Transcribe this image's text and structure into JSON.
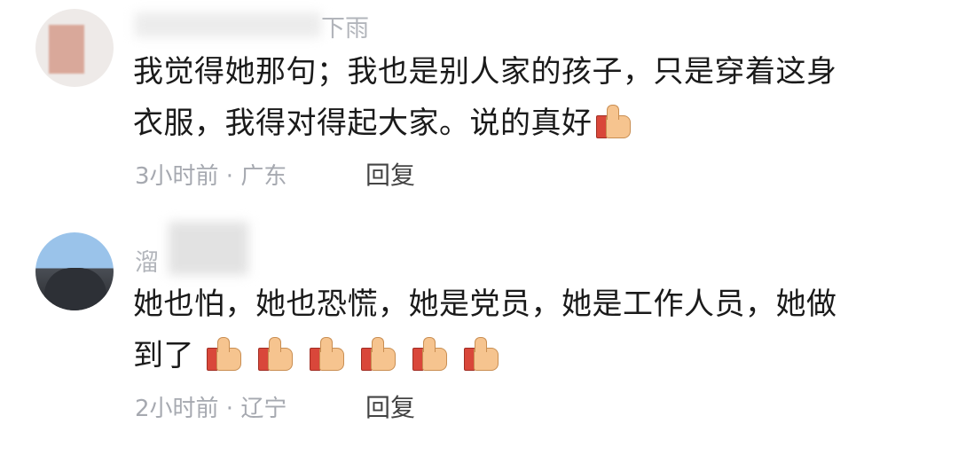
{
  "comments": [
    {
      "username_visible": "下雨",
      "text_line1": "我觉得她那句；我也是别人家的孩子，只是穿着这身",
      "text_line2": "衣服，我得对得起大家。说的真好",
      "emoji_count": 1,
      "meta": "3小时前 · 广东",
      "reply_label": "回复"
    },
    {
      "username_visible": "溜",
      "text_line1": "她也怕，她也恐慌，她是党员，她是工作人员，她做",
      "text_line2": "到了",
      "emoji_count": 6,
      "meta": "2小时前 · 辽宁",
      "reply_label": "回复"
    }
  ],
  "emoji_name": "thumbs-up"
}
